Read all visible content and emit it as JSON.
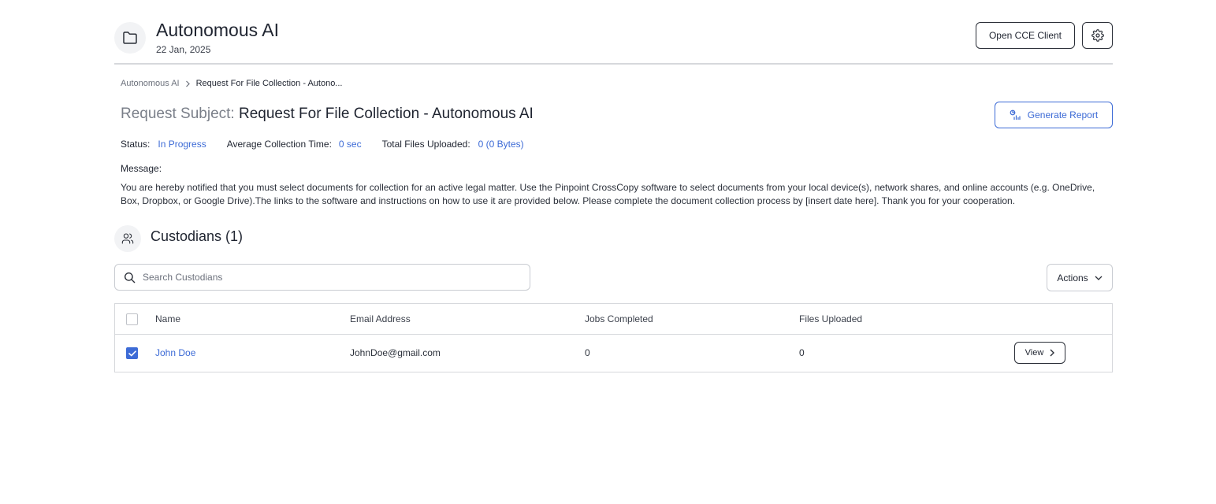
{
  "header": {
    "title": "Autonomous AI",
    "date": "22 Jan, 2025",
    "folder_icon": "folder-icon",
    "open_client_label": "Open CCE Client",
    "settings_icon": "gear-icon"
  },
  "breadcrumb": {
    "items": [
      "Autonomous AI",
      "Request For File Collection - Autono..."
    ],
    "separator_icon": "chevron-right-icon"
  },
  "request": {
    "subject_label": "Request Subject:",
    "subject_value": "Request For File Collection - Autonomous AI",
    "generate_report_label": "Generate Report",
    "generate_report_icon": "report-chart-icon",
    "status_label": "Status:",
    "status_value": "In Progress",
    "avg_time_label": "Average Collection Time:",
    "avg_time_value": "0 sec",
    "total_files_label": "Total Files Uploaded:",
    "total_files_value": "0 (0 Bytes)",
    "message_label": "Message:",
    "message_body": "You are hereby notified that you must select documents for collection for an active legal matter. Use the Pinpoint CrossCopy software to select documents from your local device(s), network shares, and online accounts (e.g. OneDrive, Box, Dropbox, or Google Drive).The links to the software and instructions on how to use it are provided below. Please complete the document collection process by [insert date here]. Thank you for your cooperation."
  },
  "custodians": {
    "title": "Custodians (1)",
    "icon": "users-icon",
    "search_placeholder": "Search Custodians",
    "search_value": "",
    "actions_label": "Actions",
    "columns": [
      "Name",
      "Email Address",
      "Jobs Completed",
      "Files Uploaded"
    ],
    "rows": [
      {
        "name": "John Doe",
        "email": "JohnDoe@gmail.com",
        "jobs_completed": "0",
        "files_uploaded": "0",
        "checked": true,
        "view_label": "View"
      }
    ]
  },
  "colors": {
    "accent": "#3d6bd6",
    "text": "#1f2430",
    "border": "#d6d8dc"
  }
}
